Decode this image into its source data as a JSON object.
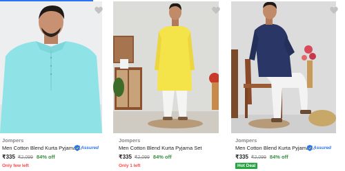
{
  "products": [
    {
      "brand": "Jompers",
      "title": "Men Cotton Blend Kurta Pyjama ...",
      "assured": true,
      "assured_label": "Assured",
      "price": "₹335",
      "mrp": "₹2,099",
      "discount": "84% off",
      "note": "Only few left",
      "image_alt": "Man in aqua blue kurta",
      "kurta_color": "#8fe3e6",
      "wishlist_icon": "heart-icon"
    },
    {
      "brand": "Jompers",
      "title": "Men Cotton Blend Kurta Pyjama Set",
      "assured": false,
      "price": "₹335",
      "mrp": "₹2,099",
      "discount": "84% off",
      "note": "Only 1 left",
      "image_alt": "Man in yellow kurta with white pyjama",
      "kurta_color": "#f5e34a",
      "wishlist_icon": "heart-icon"
    },
    {
      "brand": "Jompers",
      "title": "Men Cotton Blend Kurta Pyjama ...",
      "assured": true,
      "assured_label": "Assured",
      "price": "₹335",
      "mrp": "₹2,099",
      "discount": "84% off",
      "badge": "Hot Deal",
      "image_alt": "Man in navy kurta seated on wooden chair",
      "kurta_color": "#2a3766",
      "wishlist_icon": "heart-icon"
    }
  ],
  "colors": {
    "accent": "#2874f0",
    "discount_green": "#388e3c",
    "urgency_red": "#ff4343",
    "deal_green": "#26a541"
  }
}
